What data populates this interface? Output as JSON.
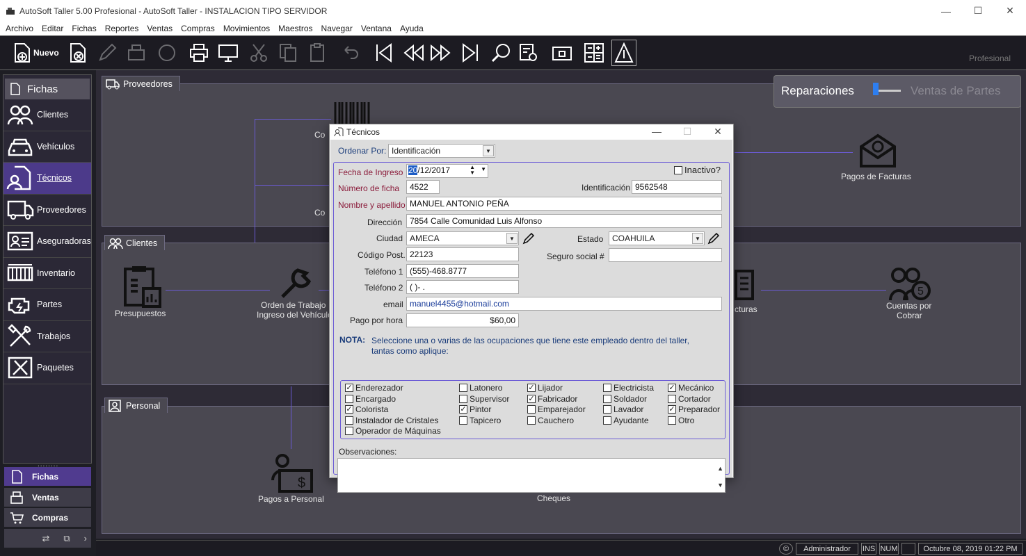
{
  "window": {
    "title": "AutoSoft Taller 5.00 Profesional - AutoSoft Taller - INSTALACION TIPO SERVIDOR"
  },
  "menu": [
    "Archivo",
    "Editar",
    "Fichas",
    "Reportes",
    "Ventas",
    "Compras",
    "Movimientos",
    "Maestros",
    "Navegar",
    "Ventana",
    "Ayuda"
  ],
  "toolbar": {
    "nuevo_label": "Nuevo",
    "edition_label": "Profesional"
  },
  "sidebar": {
    "header": "Fichas",
    "items": [
      {
        "label": "Clientes"
      },
      {
        "label": "Vehículos"
      },
      {
        "label": "Técnicos"
      },
      {
        "label": "Proveedores"
      },
      {
        "label": "Aseguradoras"
      },
      {
        "label": "Inventario"
      },
      {
        "label": "Partes"
      },
      {
        "label": "Trabajos"
      },
      {
        "label": "Paquetes"
      }
    ]
  },
  "bottom_nav": {
    "grip": "........",
    "fichas": "Fichas",
    "ventas": "Ventas",
    "compras": "Compras"
  },
  "mode_switch": {
    "left": "Reparaciones",
    "right": "Ventas de Partes"
  },
  "panels": {
    "proveedores": {
      "title": "Proveedores",
      "nodes": {
        "compras_top": "Co",
        "compras_bottom": "Co",
        "pagos_facturas": "Pagos de Facturas"
      }
    },
    "clientes": {
      "title": "Clientes",
      "nodes": {
        "presupuestos": "Presupuestos",
        "orden_1": "Orden de Trabajo",
        "orden_2": "Ingreso del Vehículo",
        "facturas": "cturas",
        "cuentas_1": "Cuentas por",
        "cuentas_2": "Cobrar"
      }
    },
    "personal": {
      "title": "Personal",
      "nodes": {
        "pagos_personal": "Pagos a Personal",
        "cheques": "Cheques"
      }
    }
  },
  "status": {
    "user": "Administrador",
    "ins": "INS",
    "num": "NUM",
    "datetime": "Octubre 08, 2019 01:22 PM"
  },
  "dialog": {
    "title": "Técnicos",
    "order_label": "Ordenar Por:",
    "order_value": "Identificación",
    "inactive_label": "Inactivo?",
    "fields": {
      "fecha_label": "Fecha de Ingreso",
      "fecha_sel": "20",
      "fecha_rest": "/12/2017",
      "numero_label": "Número de ficha",
      "numero": "4522",
      "ident_label": "Identificación",
      "ident": "9562548",
      "nombre_label": "Nombre y apellido",
      "nombre": "MANUEL ANTONIO PEÑA",
      "direccion_label": "Dirección",
      "direccion": "7854 Calle Comunidad Luis Alfonso",
      "ciudad_label": "Ciudad",
      "ciudad": "AMECA",
      "estado_label": "Estado",
      "estado": "COAHUILA",
      "cp_label": "Código Post.",
      "cp": "22123",
      "seguro_label": "Seguro social #",
      "seguro": "",
      "tel1_label": "Teléfono 1",
      "tel1": "(555)-468.8777",
      "tel2_label": "Teléfono 2",
      "tel2": "(  )-  .",
      "email_label": "email",
      "email": "manuel4455@hotmail.com",
      "pago_label": "Pago por hora",
      "pago": "$60,00"
    },
    "nota_label": "NOTA:",
    "nota_text_1": "Seleccione una o varias de las ocupaciones que tiene este empleado dentro del taller,",
    "nota_text_2": "tantas como aplique:",
    "occupations": [
      {
        "label": "Enderezador",
        "checked": true
      },
      {
        "label": "Encargado",
        "checked": false
      },
      {
        "label": "Colorista",
        "checked": true
      },
      {
        "label": "Instalador de Cristales",
        "checked": false
      },
      {
        "label": "Operador de Máquinas",
        "checked": false
      },
      {
        "label": "Latonero",
        "checked": false
      },
      {
        "label": "Supervisor",
        "checked": false
      },
      {
        "label": "Pintor",
        "checked": true
      },
      {
        "label": "Tapicero",
        "checked": false
      },
      {
        "label": "Lijador",
        "checked": true
      },
      {
        "label": "Fabricador",
        "checked": true
      },
      {
        "label": "Emparejador",
        "checked": false
      },
      {
        "label": "Cauchero",
        "checked": false
      },
      {
        "label": "Electricista",
        "checked": false
      },
      {
        "label": "Soldador",
        "checked": false
      },
      {
        "label": "Lavador",
        "checked": false
      },
      {
        "label": "Ayudante",
        "checked": false
      },
      {
        "label": "Mecánico",
        "checked": true
      },
      {
        "label": "Cortador",
        "checked": false
      },
      {
        "label": "Preparador",
        "checked": true
      },
      {
        "label": "Otro",
        "checked": false
      }
    ],
    "observaciones_label": "Observaciones:",
    "observaciones": ""
  }
}
